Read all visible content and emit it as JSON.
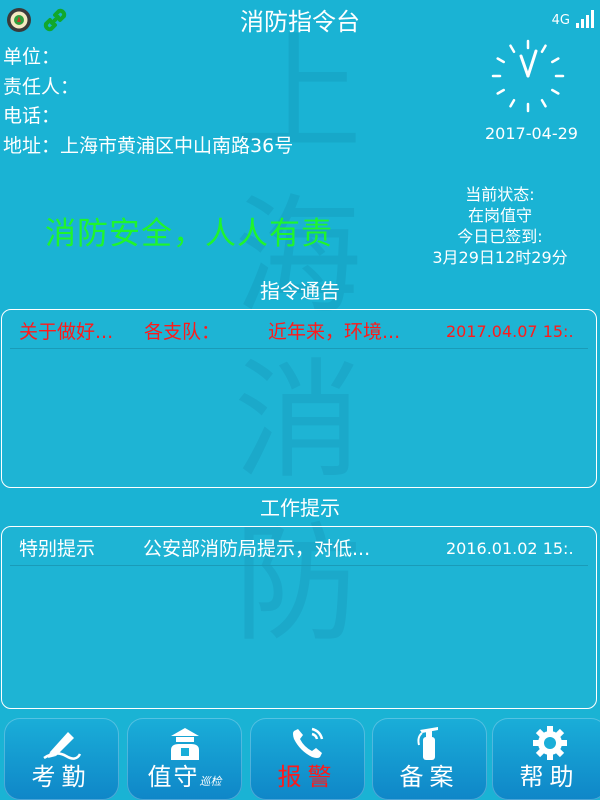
{
  "header": {
    "title": "消防指令台",
    "network": "4G"
  },
  "watermark": [
    "上",
    "海",
    "消",
    "防"
  ],
  "info": {
    "unit_label": "单位：",
    "person_label": "责任人：",
    "phone_label": "电话：",
    "address_label": "地址：",
    "address_value": "上海市黄浦区中山南路36号"
  },
  "date": "2017-04-29",
  "slogan": "消防安全，人人有责",
  "state": {
    "label": "当前状态:",
    "value": "在岗值守",
    "sign_label": "今日已签到:",
    "sign_time": "3月29日12时29分"
  },
  "notices": {
    "title": "指令通告",
    "items": [
      {
        "title": "关于做好...",
        "from": "各支队：",
        "content": "近年来，环境...",
        "date": "2017.04.07 15:."
      }
    ]
  },
  "tips": {
    "title": "工作提示",
    "items": [
      {
        "title": "特别提示",
        "content": "公安部消防局提示，对低...",
        "date": "2016.01.02 15:."
      }
    ]
  },
  "nav": {
    "attendance": "考勤",
    "duty": "值守",
    "duty_sub": "巡检",
    "alarm": "报警",
    "record": "备案",
    "help": "帮助"
  },
  "colors": {
    "background": "#1ab3d4",
    "slogan": "#1ff52c",
    "alarm": "#ff1a1a",
    "notice": "#ff1a1a"
  }
}
